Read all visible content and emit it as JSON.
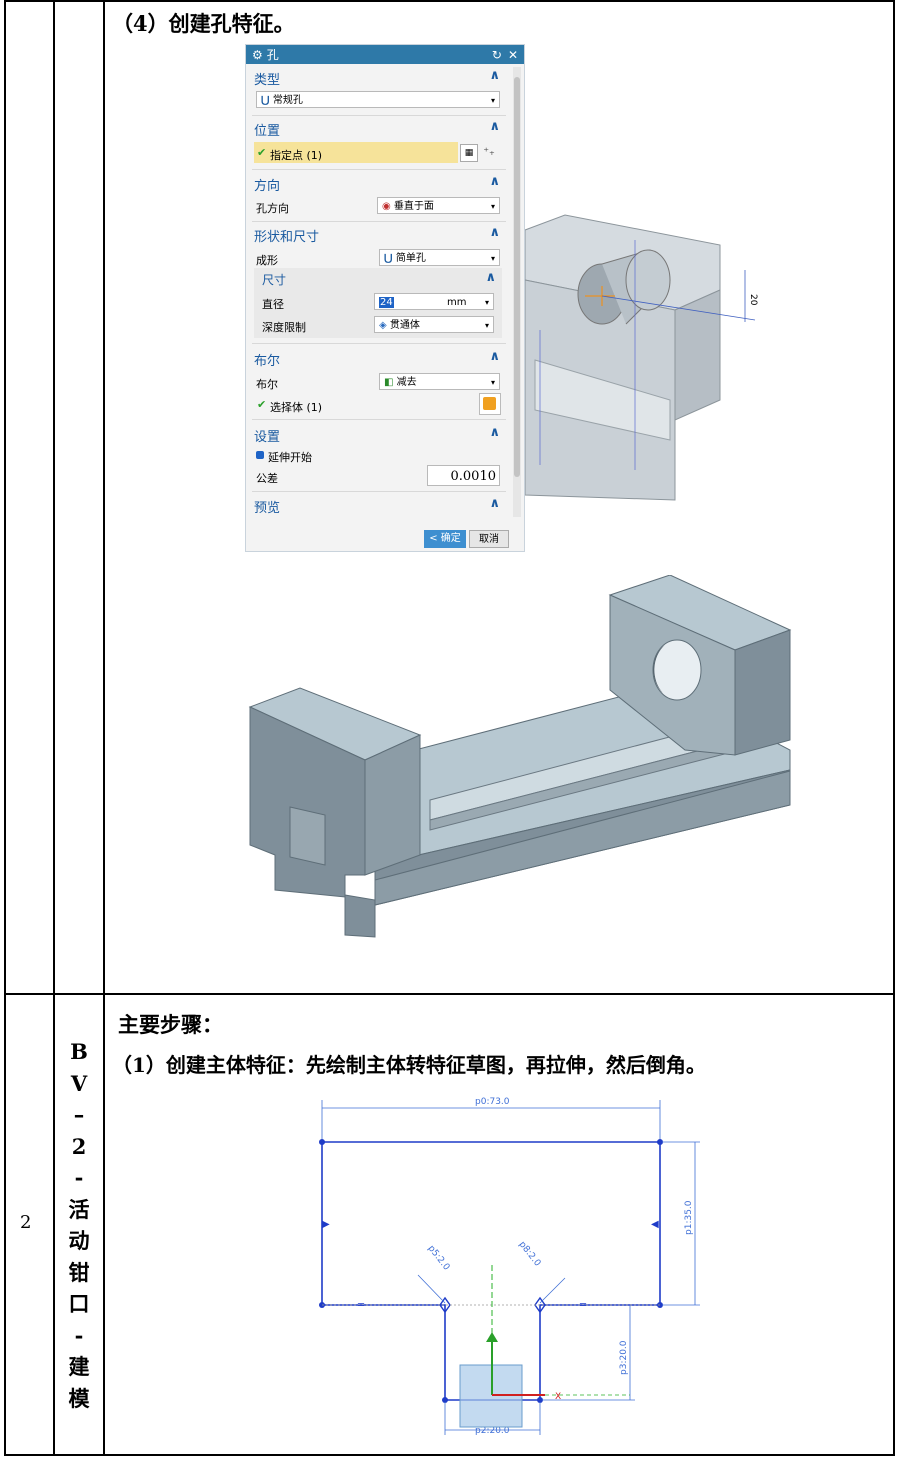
{
  "row1": {
    "step_heading": "（4）创建孔特征。"
  },
  "dialog": {
    "title": "孔",
    "sections": {
      "type": {
        "header": "类型",
        "value": "常规孔"
      },
      "position": {
        "header": "位置",
        "point_label": "指定点 (1)"
      },
      "direction": {
        "header": "方向",
        "label": "孔方向",
        "value": "垂直于面"
      },
      "shape": {
        "header": "形状和尺寸",
        "form_label": "成形",
        "form_value": "简单孔",
        "dims_header": "尺寸",
        "diameter_label": "直径",
        "diameter_value": "24",
        "diameter_unit": "mm",
        "depth_label": "深度限制",
        "depth_value": "贯通体"
      },
      "boolean": {
        "header": "布尔",
        "label": "布尔",
        "value": "减去",
        "select_body": "选择体 (1)"
      },
      "settings": {
        "header": "设置",
        "extend_start": "延伸开始",
        "tolerance_label": "公差",
        "tolerance_value": "0.0010"
      },
      "preview": {
        "header": "预览"
      }
    },
    "ok_label": "< 确定 >",
    "cancel_label": "取消"
  },
  "model_dim": {
    "label": "20"
  },
  "row2": {
    "number": "2",
    "vertical_title": [
      "B",
      "V",
      "–",
      "2",
      "-",
      "活",
      "动",
      "钳",
      "口",
      "-",
      "建",
      "模"
    ],
    "heading": "主要步骤：",
    "step1": "（1）创建主体特征：先绘制主体转特征草图，再拉伸，然后倒角。"
  },
  "sketch": {
    "dim_p0": "p0:73.0",
    "dim_p1": "p1:35.0",
    "dim_p2": "p2:20.0",
    "dim_p3": "p3:20.0",
    "dim_p5": "p5:2.0",
    "dim_p8": "p8:2.0",
    "axis_x": "X"
  },
  "colors": {
    "sketch_line": "#1f3cc8",
    "dim_line": "#3f6fd6",
    "dialog_title_bg": "#2e79a8",
    "highlight": "#f6e39a",
    "model_face": "#7f8f9a",
    "model_top": "#b9c9d2"
  }
}
